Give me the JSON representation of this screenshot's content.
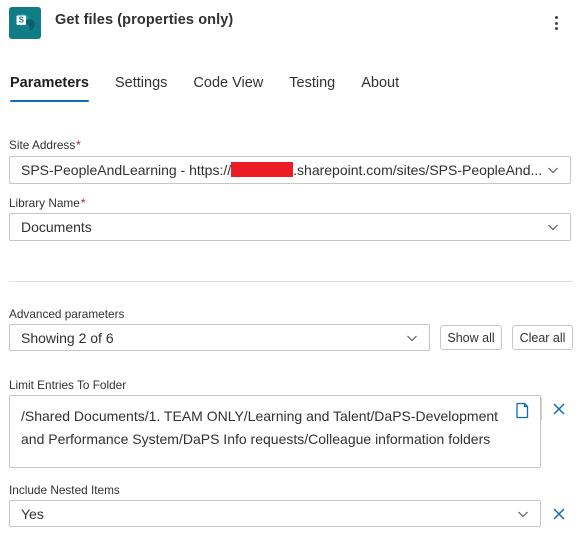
{
  "header": {
    "icon_name": "sharepoint-icon",
    "icon_letter": "S",
    "title": "Get files (properties only)",
    "more_options_label": "More commands"
  },
  "tabs": [
    {
      "label": "Parameters",
      "active": true
    },
    {
      "label": "Settings",
      "active": false
    },
    {
      "label": "Code View",
      "active": false
    },
    {
      "label": "Testing",
      "active": false
    },
    {
      "label": "About",
      "active": false
    }
  ],
  "fields": {
    "site_address": {
      "label": "Site Address",
      "required_marker": "*",
      "value_prefix": "SPS-PeopleAndLearning - https://",
      "value_suffix": ".sharepoint.com/sites/SPS-PeopleAnd...",
      "redacted": true,
      "redaction_color": "#ec1c24"
    },
    "library_name": {
      "label": "Library Name",
      "required_marker": "*",
      "value": "Documents"
    },
    "advanced_parameters": {
      "label": "Advanced parameters",
      "value": "Showing 2 of 6",
      "show_all_label": "Show all",
      "clear_all_label": "Clear all"
    },
    "limit_entries_to_folder": {
      "label": "Limit Entries To Folder",
      "value": "/Shared Documents/1. TEAM ONLY/Learning and Talent/DaPS-Development and Performance System/DaPS Info requests/Colleague information folders",
      "picker_icon": "folder-picker-icon",
      "clear_icon": "close-icon"
    },
    "include_nested_items": {
      "label": "Include Nested Items",
      "value": "Yes",
      "clear_icon": "close-icon"
    }
  },
  "colors": {
    "accent": "#0f6cbd",
    "brand_icon": "#0f7c86",
    "required": "#a4262c",
    "border": "#c8c6c4"
  }
}
